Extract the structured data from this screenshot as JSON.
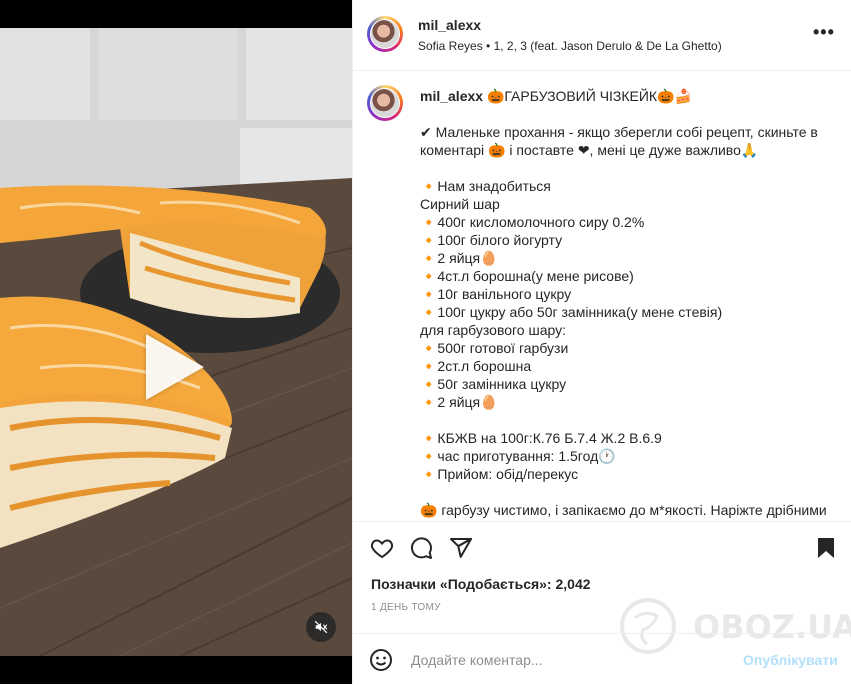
{
  "header": {
    "username": "mil_alexx",
    "audio": "Sofia Reyes • 1, 2, 3 (feat. Jason Derulo & De La Ghetto)",
    "more_label": "•••"
  },
  "caption": {
    "username": "mil_alexx",
    "text": " 🎃ГАРБУЗОВИЙ ЧІЗКЕЙК🎃🍰\n\n✔ Маленьке прохання - якщо зберегли собі рецепт, скиньте в коментарі 🎃 і поставте ❤, мені це дуже важливо🙏\n\n🔸Нам знадобиться\nСирний шар\n🔸400г кисломолочного сиру 0.2%\n🔸100г білого йогурту\n🔸2 яйця🥚\n🔸4ст.л борошна(у мене рисове)\n🔸10г ванільного цукру\n🔸100г цукру або 50г замінника(у мене стевія)\nдля гарбузового шару:\n🔸500г готової гарбузи\n🔸2ст.л борошна\n🔸50г замінника цукру\n🔸2 яйця🥚\n\n🔸КБЖВ на 100г:К.76 Б.7.4 Ж.2 В.6.9\n🔸час приготування: 1.5год🕐\n🔸Прийом: обід/перекус\n\n🎃 гарбузу чистимо, і запікаємо до м*якості. Наріжте дрібними"
  },
  "likes_text": "Позначки «Подобається»: 2,042",
  "time_text": "1 ДЕНЬ ТОМУ",
  "comment": {
    "placeholder": "Додайте коментар...",
    "publish_label": "Опублікувати"
  },
  "watermark_text": "OBOZ.UA",
  "colors": {
    "accent": "#0095f6",
    "publish_disabled": "#b2dffc",
    "text": "#262626",
    "muted": "#8e8e8e",
    "border": "#efefef"
  },
  "icons": [
    "heart-icon",
    "comment-icon",
    "share-icon",
    "bookmark-icon",
    "emoji-icon",
    "mute-icon",
    "play-icon",
    "more-icon"
  ]
}
